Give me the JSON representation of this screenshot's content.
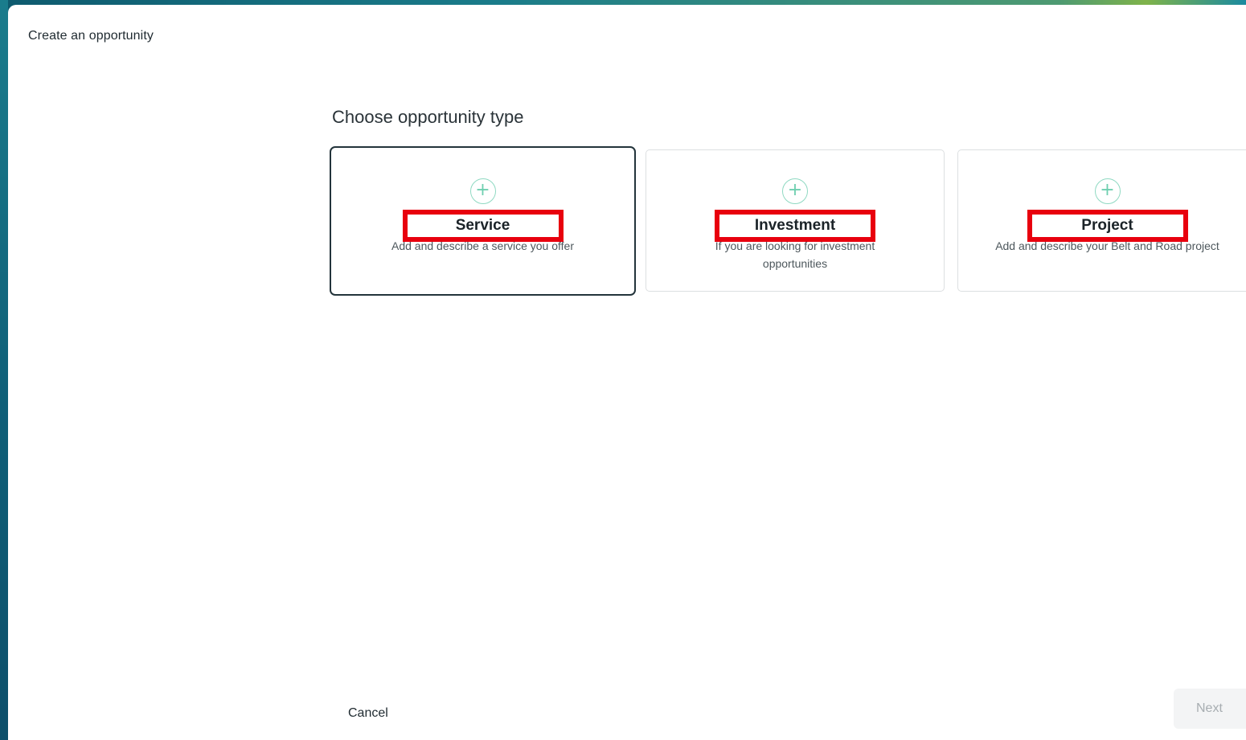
{
  "modal": {
    "title": "Create an opportunity"
  },
  "section": {
    "heading": "Choose opportunity type"
  },
  "cards": [
    {
      "icon": "plus-circle-icon",
      "label": "Service",
      "description": "Add and describe a service you offer",
      "selected": true
    },
    {
      "icon": "plus-circle-icon",
      "label": "Investment",
      "description": "If you are looking for investment opportunities",
      "selected": false
    },
    {
      "icon": "plus-circle-icon",
      "label": "Project",
      "description": "Add and describe your Belt and Road project",
      "selected": false
    }
  ],
  "footer": {
    "cancel_label": "Cancel",
    "next_label": "Next"
  },
  "colors": {
    "accent_mint": "#8fd9c2",
    "highlight_red": "#e8000e",
    "selected_border": "#23343b"
  }
}
